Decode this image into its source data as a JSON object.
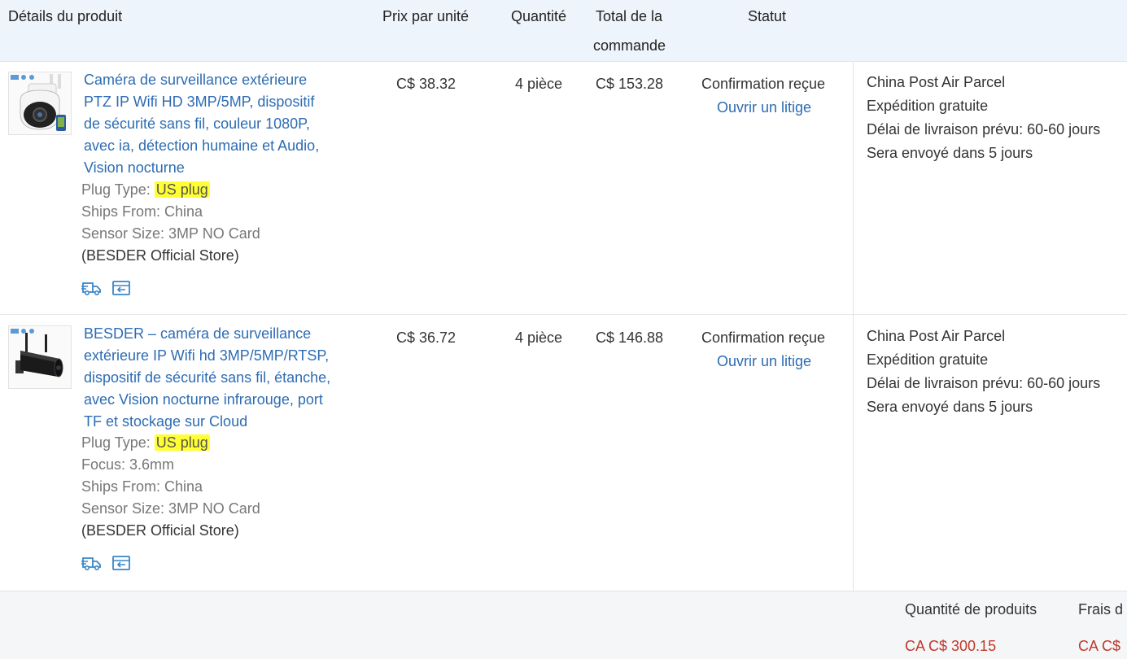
{
  "header": {
    "product_details": "Détails du produit",
    "unit_price": "Prix par unité",
    "quantity": "Quantité",
    "order_total_line1": "Total de la",
    "order_total_line2": "commande",
    "status": "Statut"
  },
  "orders": [
    {
      "title_lines": [
        "Caméra de surveillance extérieure",
        "PTZ IP Wifi HD 3MP/5MP, dispositif",
        "de sécurité sans fil, couleur 1080P,",
        "avec ia, détection humaine et Audio,",
        "Vision nocturne"
      ],
      "plug_label": "Plug Type:",
      "plug_value": "US plug",
      "attrs": [
        "Ships From: China",
        "Sensor Size: 3MP NO Card"
      ],
      "store": "(BESDER Official Store)",
      "price": "C$ 38.32",
      "qty": "4 pièce",
      "total": "C$ 153.28",
      "status": "Confirmation reçue",
      "dispute": "Ouvrir un litige",
      "carrier": "China Post Air Parcel",
      "free_shipping": "Expédition gratuite",
      "delivery": "Délai de livraison prévu:",
      "delivery_days": "60-60 jours",
      "ships_in": "Sera envoyé dans 5 jours"
    },
    {
      "title_lines": [
        "BESDER – caméra de surveillance",
        "extérieure IP Wifi hd 3MP/5MP/RTSP,",
        "dispositif de sécurité sans fil, étanche,",
        "avec Vision nocturne infrarouge, port",
        "TF et stockage sur Cloud"
      ],
      "plug_label": "Plug Type:",
      "plug_value": "US plug",
      "attrs": [
        "Focus: 3.6mm",
        "Ships From: China",
        "Sensor Size: 3MP NO Card"
      ],
      "store": "(BESDER Official Store)",
      "price": "C$ 36.72",
      "qty": "4 pièce",
      "total": "C$ 146.88",
      "status": "Confirmation reçue",
      "dispute": "Ouvrir un litige",
      "carrier": "China Post Air Parcel",
      "free_shipping": "Expédition gratuite",
      "delivery": "Délai de livraison prévu:",
      "delivery_days": "60-60 jours",
      "ships_in": "Sera envoyé dans 5 jours"
    }
  ],
  "footer": {
    "products_qty_label": "Quantité de produits",
    "products_amount": "CA C$ 300.15",
    "shipping_label": "Frais d",
    "shipping_amount": "CA C$"
  },
  "colors": {
    "header_bg": "#eef4fb",
    "link": "#2d6cb3",
    "free_shipping": "#2ea02e",
    "highlight": "#ffff33",
    "amount_red": "#c0392b"
  },
  "icons": [
    "camera-ptz-thumbnail",
    "camera-bullet-thumbnail",
    "truck-icon",
    "return-icon"
  ]
}
